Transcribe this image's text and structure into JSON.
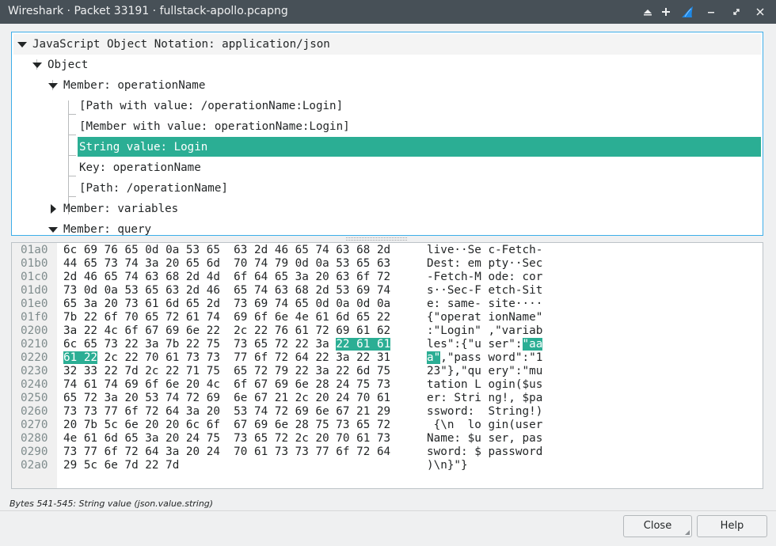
{
  "window": {
    "title": "Wireshark · Packet 33191 · fullstack-apollo.pcapng",
    "buttons": {
      "shade": "⏶",
      "keep_above": "+",
      "minimize": "⌄",
      "restore": "⤡",
      "close": "✕"
    },
    "app_icon": "wireshark-fin-icon"
  },
  "tree": {
    "rows": [
      {
        "label": "JavaScript Object Notation: application/json",
        "expander": "expanded"
      },
      {
        "label": "Object",
        "expander": "expanded"
      },
      {
        "label": "Member: operationName",
        "expander": "expanded"
      },
      {
        "label": "[Path with value: /operationName:Login]",
        "expander": "none"
      },
      {
        "label": "[Member with value: operationName:Login]",
        "expander": "none"
      },
      {
        "label": "String value: Login",
        "expander": "none",
        "selected": true
      },
      {
        "label": "Key: operationName",
        "expander": "none"
      },
      {
        "label": "[Path: /operationName]",
        "expander": "none"
      },
      {
        "label": "Member: variables",
        "expander": "collapsed"
      },
      {
        "label": "Member: query",
        "expander": "expanded"
      }
    ]
  },
  "hex": {
    "lines": [
      {
        "offset": "01a0",
        "hex": "6c 69 76 65 0d 0a 53 65  63 2d 46 65 74 63 68 2d",
        "ascii": "live··Se c-Fetch-"
      },
      {
        "offset": "01b0",
        "hex": "44 65 73 74 3a 20 65 6d  70 74 79 0d 0a 53 65 63",
        "ascii": "Dest: em pty··Sec"
      },
      {
        "offset": "01c0",
        "hex": "2d 46 65 74 63 68 2d 4d  6f 64 65 3a 20 63 6f 72",
        "ascii": "-Fetch-M ode: cor"
      },
      {
        "offset": "01d0",
        "hex": "73 0d 0a 53 65 63 2d 46  65 74 63 68 2d 53 69 74",
        "ascii": "s··Sec-F etch-Sit"
      },
      {
        "offset": "01e0",
        "hex": "65 3a 20 73 61 6d 65 2d  73 69 74 65 0d 0a 0d 0a",
        "ascii": "e: same- site····"
      },
      {
        "offset": "01f0",
        "hex": "7b 22 6f 70 65 72 61 74  69 6f 6e 4e 61 6d 65 22",
        "ascii": "{\"operat ionName\""
      },
      {
        "offset": "0200",
        "hex": "3a 22 4c 6f 67 69 6e 22  2c 22 76 61 72 69 61 62",
        "ascii": ":\"Login\" ,\"variab"
      },
      {
        "offset": "0210",
        "hex": "6c 65 73 22 3a 7b 22 75  73 65 72 22 3a ",
        "hex_hl": "22 61 61",
        "hex_post": "",
        "ascii": "les\":{\"u ser\":",
        "ascii_hl": "\"aa",
        "ascii_post": ""
      },
      {
        "offset": "0220",
        "hex": "",
        "hex_hl": "61 22",
        "hex_post": " 2c 22 70 61 73 73  77 6f 72 64 22 3a 22 31",
        "ascii": "",
        "ascii_hl": "a\"",
        "ascii_post": ",\"pass word\":\"1"
      },
      {
        "offset": "0230",
        "hex": "32 33 22 7d 2c 22 71 75  65 72 79 22 3a 22 6d 75",
        "ascii": "23\"},\"qu ery\":\"mu"
      },
      {
        "offset": "0240",
        "hex": "74 61 74 69 6f 6e 20 4c  6f 67 69 6e 28 24 75 73",
        "ascii": "tation L ogin($us"
      },
      {
        "offset": "0250",
        "hex": "65 72 3a 20 53 74 72 69  6e 67 21 2c 20 24 70 61",
        "ascii": "er: Stri ng!, $pa"
      },
      {
        "offset": "0260",
        "hex": "73 73 77 6f 72 64 3a 20  53 74 72 69 6e 67 21 29",
        "ascii": "ssword:  String!)"
      },
      {
        "offset": "0270",
        "hex": "20 7b 5c 6e 20 20 6c 6f  67 69 6e 28 75 73 65 72",
        "ascii": " {\\n  lo gin(user"
      },
      {
        "offset": "0280",
        "hex": "4e 61 6d 65 3a 20 24 75  73 65 72 2c 20 70 61 73",
        "ascii": "Name: $u ser, pas"
      },
      {
        "offset": "0290",
        "hex": "73 77 6f 72 64 3a 20 24  70 61 73 73 77 6f 72 64",
        "ascii": "sword: $ password"
      },
      {
        "offset": "02a0",
        "hex": "29 5c 6e 7d 22 7d",
        "ascii": ")\\n}\"}"
      }
    ]
  },
  "status": {
    "text": "Bytes 541-545: String value (json.value.string)"
  },
  "footer": {
    "close_label": "Close",
    "help_label": "Help"
  },
  "colors": {
    "accent": "#2bae94",
    "titlebar": "#475057",
    "focus": "#3daee9"
  }
}
